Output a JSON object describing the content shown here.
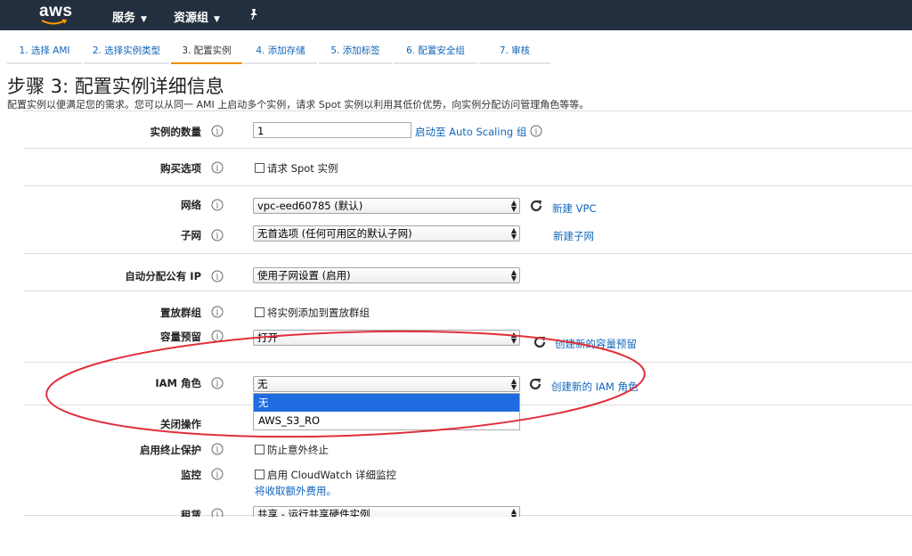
{
  "header": {
    "logo": "aws",
    "nav_services": "服务",
    "nav_resource_groups": "资源组"
  },
  "wizard_steps": [
    {
      "label": "1. 选择 AMI"
    },
    {
      "label": "2. 选择实例类型"
    },
    {
      "label": "3. 配置实例"
    },
    {
      "label": "4. 添加存储"
    },
    {
      "label": "5. 添加标签"
    },
    {
      "label": "6. 配置安全组"
    },
    {
      "label": "7. 审核"
    }
  ],
  "active_step_index": 2,
  "page": {
    "title": "步骤 3: 配置实例详细信息",
    "description": "配置实例以便满足您的需求。您可以从同一 AMI 上启动多个实例，请求 Spot 实例以利用其低价优势，向实例分配访问管理角色等等。"
  },
  "form": {
    "instance_count": {
      "label": "实例的数量",
      "value": "1",
      "link": "启动至 Auto Scaling 组"
    },
    "purchase_option": {
      "label": "购买选项",
      "checkbox": "请求 Spot 实例"
    },
    "network": {
      "label": "网络",
      "value": "vpc-eed60785 (默认)",
      "link": "新建 VPC"
    },
    "subnet": {
      "label": "子网",
      "value": "无首选项 (任何可用区的默认子网)",
      "link": "新建子网"
    },
    "public_ip": {
      "label": "自动分配公有 IP",
      "value": "使用子网设置 (启用)"
    },
    "placement_group": {
      "label": "置放群组",
      "checkbox": "将实例添加到置放群组"
    },
    "capacity_reservation": {
      "label": "容量预留",
      "value": "打开",
      "link": "创建新的容量预留"
    },
    "iam_role": {
      "label": "IAM 角色",
      "value": "无",
      "link": "创建新的 IAM 角色",
      "options": [
        "无",
        "AWS_S3_RO"
      ],
      "highlighted_option": "无"
    },
    "shutdown": {
      "label": "关闭操作"
    },
    "termination_protection": {
      "label": "启用终止保护",
      "checkbox": "防止意外终止"
    },
    "monitoring": {
      "label": "监控",
      "checkbox": "启用 CloudWatch 详细监控",
      "note": "将收取额外费用。"
    },
    "tenancy": {
      "label": "租赁",
      "value": "共享 - 运行共享硬件实例"
    }
  },
  "colors": {
    "topbar": "#232f3e",
    "link": "#1166bb",
    "active_step": "#f08c00",
    "dropdown_highlight": "#1e6ce0",
    "annotation": "#e0303a"
  }
}
